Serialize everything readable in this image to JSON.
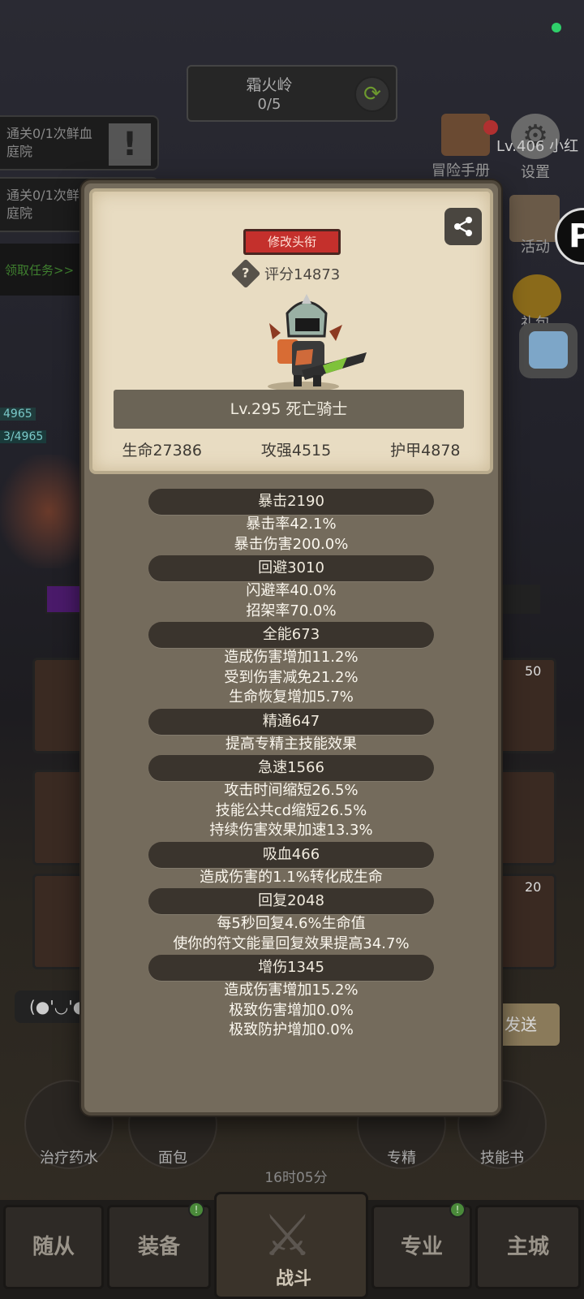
{
  "background": {
    "map": {
      "name": "霜火岭",
      "progress": "0/5"
    },
    "quests": [
      {
        "text": "通关0/1次鲜血庭院"
      },
      {
        "text": "通关0/1次鲜血庭院"
      }
    ],
    "claim_task": "领取任务>>",
    "right_menu": {
      "adventure_book": "冒险手册",
      "settings": "设置",
      "user_level": "Lv.406 小红",
      "activity": "活动",
      "gift": "礼包"
    },
    "hp_tags": [
      "4965",
      "3/4965"
    ],
    "slot_numbers": [
      "50",
      "20"
    ],
    "chat_emoticon": "(●'◡'●",
    "send_label": "发送",
    "items": [
      "治疗药水",
      "面包",
      "专精",
      "技能书"
    ],
    "timer": "16时05分",
    "nav": {
      "tabs": [
        "随从",
        "装备",
        "战斗",
        "专业",
        "主城"
      ],
      "badges": [
        "!",
        "!"
      ]
    }
  },
  "modal": {
    "title_button": "修改头衔",
    "help_symbol": "?",
    "score": "评分14873",
    "name": "Lv.295 死亡骑士",
    "core_stats": [
      "生命27386",
      "攻强4515",
      "护甲4878"
    ],
    "stat_groups": [
      {
        "header": "暴击2190",
        "lines": [
          "暴击率42.1%",
          "暴击伤害200.0%"
        ]
      },
      {
        "header": "回避3010",
        "lines": [
          "闪避率40.0%",
          "招架率70.0%"
        ]
      },
      {
        "header": "全能673",
        "lines": [
          "造成伤害增加11.2%",
          "受到伤害减免21.2%",
          "生命恢复增加5.7%"
        ]
      },
      {
        "header": "精通647",
        "lines": [
          "提高专精主技能效果"
        ]
      },
      {
        "header": "急速1566",
        "lines": [
          "攻击时间缩短26.5%",
          "技能公共cd缩短26.5%",
          "持续伤害效果加速13.3%"
        ]
      },
      {
        "header": "吸血466",
        "lines": [
          "造成伤害的1.1%转化成生命"
        ]
      },
      {
        "header": "回复2048",
        "lines": [
          "每5秒回复4.6%生命值",
          "使你的符文能量回复效果提高34.7%"
        ]
      },
      {
        "header": "增伤1345",
        "lines": [
          "造成伤害增加15.2%",
          "极致伤害增加0.0%",
          "极致防护增加0.0%"
        ]
      }
    ]
  },
  "colors": {
    "title_button": "#c4302c",
    "card_background": "#e8dcc2",
    "modal_background": "#746b5c",
    "stat_header": "#3a342d"
  }
}
